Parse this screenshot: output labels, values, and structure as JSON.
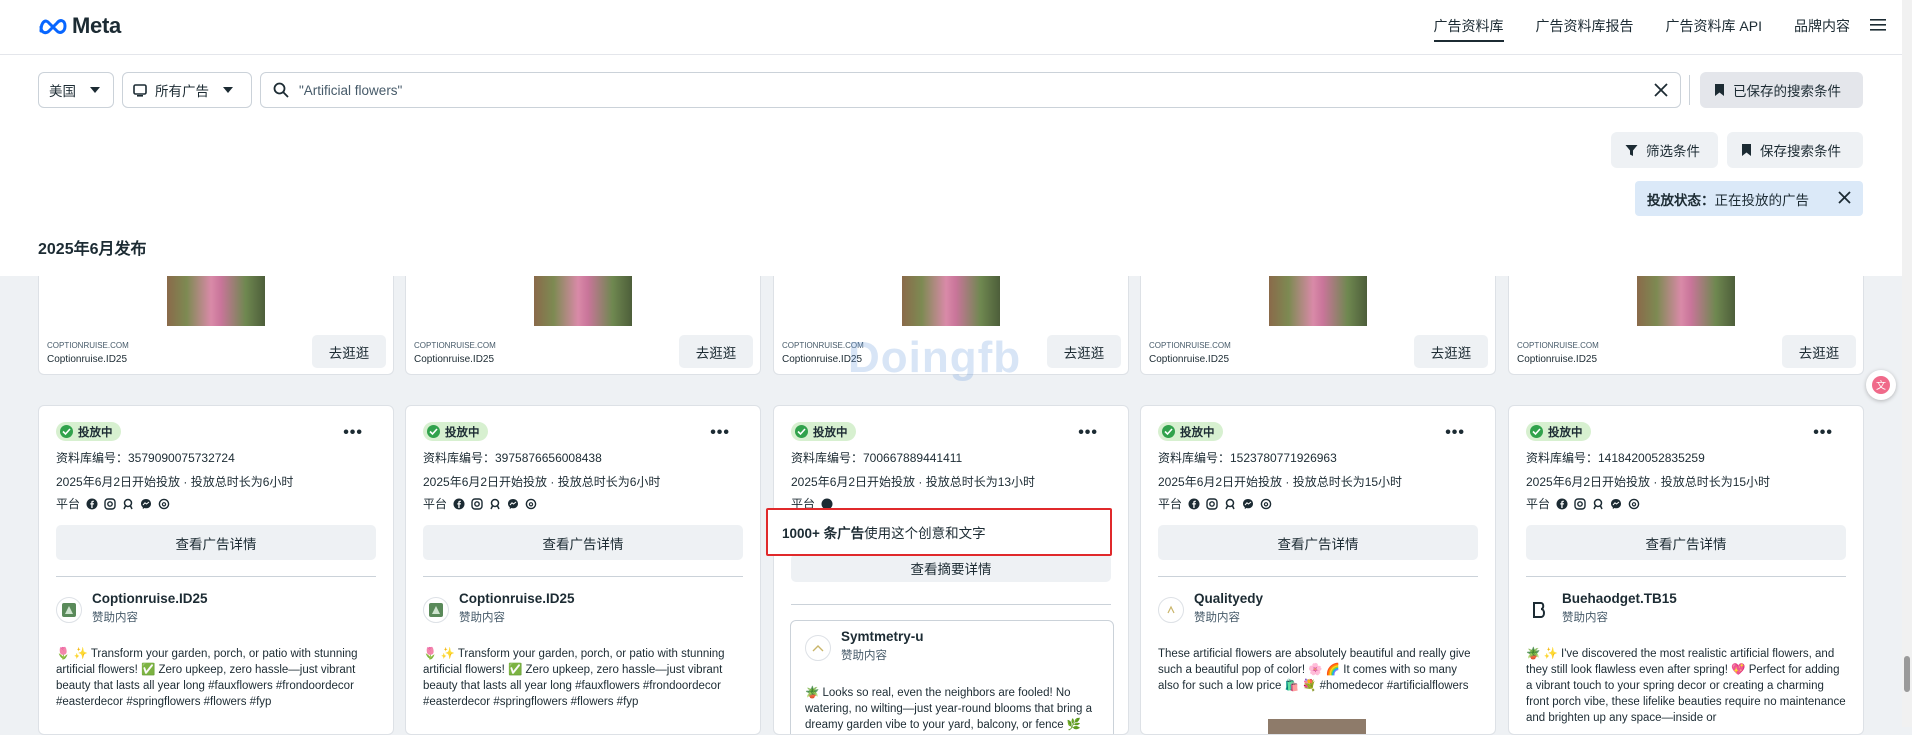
{
  "header": {
    "logo_text": "Meta",
    "nav": [
      {
        "label": "广告资料库",
        "active": true
      },
      {
        "label": "广告资料库报告",
        "active": false
      },
      {
        "label": "广告资料库 API",
        "active": false
      },
      {
        "label": "品牌内容",
        "active": false
      }
    ]
  },
  "search": {
    "country": "美国",
    "ad_category": "所有广告",
    "query": "\"Artificial flowers\"",
    "saved_searches_label": "已保存的搜索条件"
  },
  "filters": {
    "filter_label": "筛选条件",
    "save_label": "保存搜索条件",
    "status_key": "投放状态：",
    "status_value": "正在投放的广告"
  },
  "section_title": "2025年6月发布",
  "top_cards": [
    {
      "domain": "COPTIONRUISE.COM",
      "name": "Coptionruise.ID25",
      "cta": "去逛逛"
    },
    {
      "domain": "COPTIONRUISE.COM",
      "name": "Coptionruise.ID25",
      "cta": "去逛逛"
    },
    {
      "domain": "COPTIONRUISE.COM",
      "name": "Coptionruise.ID25",
      "cta": "去逛逛"
    },
    {
      "domain": "COPTIONRUISE.COM",
      "name": "Coptionruise.ID25",
      "cta": "去逛逛"
    },
    {
      "domain": "COPTIONRUISE.COM",
      "name": "Coptionruise.ID25",
      "cta": "去逛逛"
    }
  ],
  "cards": [
    {
      "status": "投放中",
      "library_id": "资料库编号：3579090075732724",
      "run_info": "2025年6月2日开始投放 · 投放总时长为6小时",
      "platform_label": "平台",
      "detail_btn": "查看广告详情",
      "advertiser": "Coptionruise.ID25",
      "sponsored": "赞助内容",
      "body": "🌷 ✨ Transform your garden, porch, or patio with stunning artificial flowers! ✅ Zero upkeep, zero hassle—just vibrant beauty that lasts all year long #fauxflowers #frondoordecor #easterdecor #springflowers #flowers #fyp"
    },
    {
      "status": "投放中",
      "library_id": "资料库编号：3975876656008438",
      "run_info": "2025年6月2日开始投放 · 投放总时长为6小时",
      "platform_label": "平台",
      "detail_btn": "查看广告详情",
      "advertiser": "Coptionruise.ID25",
      "sponsored": "赞助内容",
      "body": "🌷 ✨ Transform your garden, porch, or patio with stunning artificial flowers! ✅ Zero upkeep, zero hassle—just vibrant beauty that lasts all year long #fauxflowers #frondoordecor #easterdecor #springflowers #flowers #fyp"
    },
    {
      "status": "投放中",
      "library_id": "资料库编号：700667889441411",
      "run_info": "2025年6月2日开始投放 · 投放总时长为13小时",
      "platform_label": "平台",
      "multi_count": "1000+ 条广告",
      "multi_suffix": "使用这个创意和文字",
      "summary_btn": "查看摘要详情",
      "advertiser": "Symtmetry-u",
      "sponsored": "赞助内容",
      "body": "🪴 Looks so real, even the neighbors are fooled! No watering, no wilting—just year-round blooms that bring a dreamy garden vibe to your yard, balcony, or fence 🌿"
    },
    {
      "status": "投放中",
      "library_id": "资料库编号：1523780771926963",
      "run_info": "2025年6月2日开始投放 · 投放总时长为15小时",
      "platform_label": "平台",
      "detail_btn": "查看广告详情",
      "advertiser": "Qualityedy",
      "sponsored": "赞助内容",
      "body": "These artificial flowers are absolutely beautiful and really give such a beautiful pop of color! 🌸 🌈 It comes with so many also for such a low price 🛍️ 💐 #homedecor #artificialflowers"
    },
    {
      "status": "投放中",
      "library_id": "资料库编号：1418420052835259",
      "run_info": "2025年6月2日开始投放 · 投放总时长为15小时",
      "platform_label": "平台",
      "detail_btn": "查看广告详情",
      "advertiser": "Buehaodget.TB15",
      "sponsored": "赞助内容",
      "body": "🪴 ✨ I've discovered the most realistic artificial flowers, and they still look flawless even after spring! 💖 Perfect for adding a vibrant touch to your spring decor or creating a charming front porch vibe, these lifelike beauties require no maintenance and brighten up any space—inside or"
    }
  ],
  "watermark": "Doingfb"
}
